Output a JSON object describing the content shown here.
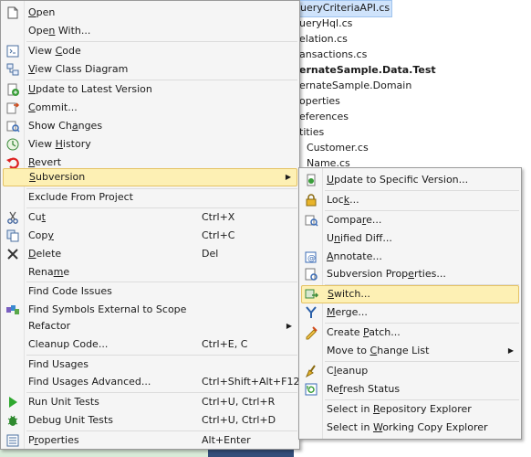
{
  "explorer": {
    "items": [
      {
        "text": "ueryCriteriaAPI.cs"
      },
      {
        "text": "ueryHql.cs"
      },
      {
        "text": "elation.cs"
      },
      {
        "text": "ansactions.cs"
      },
      {
        "text": "ernateSample.Data.Test"
      },
      {
        "text": "ernateSample.Domain"
      },
      {
        "text": "operties"
      },
      {
        "text": "eferences"
      },
      {
        "text": "tities"
      },
      {
        "text": "Customer.cs"
      },
      {
        "text": "Name.cs"
      }
    ]
  },
  "context_menu": {
    "items": [
      {
        "pre": "",
        "acc": "O",
        "post": "pen",
        "shortcut": "",
        "icon": "open-document-icon"
      },
      {
        "pre": "Ope",
        "acc": "n",
        "post": " With...",
        "shortcut": "",
        "icon": ""
      },
      {
        "pre": "View ",
        "acc": "C",
        "post": "ode",
        "shortcut": "",
        "icon": "view-code-icon"
      },
      {
        "pre": "",
        "acc": "V",
        "post": "iew Class Diagram",
        "shortcut": "",
        "icon": "class-diagram-icon"
      },
      {
        "pre": "",
        "acc": "U",
        "post": "pdate to Latest Version",
        "shortcut": "",
        "icon": "update-icon"
      },
      {
        "pre": "",
        "acc": "C",
        "post": "ommit...",
        "shortcut": "",
        "icon": "commit-icon"
      },
      {
        "pre": "Show Ch",
        "acc": "a",
        "post": "nges",
        "shortcut": "",
        "icon": "show-changes-icon"
      },
      {
        "pre": "View ",
        "acc": "H",
        "post": "istory",
        "shortcut": "",
        "icon": "history-icon"
      },
      {
        "pre": "",
        "acc": "R",
        "post": "evert",
        "shortcut": "",
        "icon": "revert-icon"
      },
      {
        "pre": "",
        "acc": "S",
        "post": "ubversion",
        "shortcut": "",
        "icon": ""
      },
      {
        "pre": "Exclude From Project",
        "acc": "",
        "post": "",
        "shortcut": "",
        "icon": ""
      },
      {
        "pre": "Cu",
        "acc": "t",
        "post": "",
        "shortcut": "Ctrl+X",
        "icon": "cut-icon"
      },
      {
        "pre": "Cop",
        "acc": "y",
        "post": "",
        "shortcut": "Ctrl+C",
        "icon": "copy-icon"
      },
      {
        "pre": "",
        "acc": "D",
        "post": "elete",
        "shortcut": "Del",
        "icon": "delete-icon"
      },
      {
        "pre": "Rena",
        "acc": "m",
        "post": "e",
        "shortcut": "",
        "icon": ""
      },
      {
        "pre": "Find Code Issues",
        "acc": "",
        "post": "",
        "shortcut": "",
        "icon": ""
      },
      {
        "pre": "Find Symbols External to Scope",
        "acc": "",
        "post": "",
        "shortcut": "",
        "icon": "find-symbols-icon"
      },
      {
        "pre": "Refactor",
        "acc": "",
        "post": "",
        "shortcut": "",
        "icon": ""
      },
      {
        "pre": "Cleanup Code...",
        "acc": "",
        "post": "",
        "shortcut": "Ctrl+E, C",
        "icon": ""
      },
      {
        "pre": "Find Usages",
        "acc": "",
        "post": "",
        "shortcut": "",
        "icon": ""
      },
      {
        "pre": "Find Usages Advanced...",
        "acc": "",
        "post": "",
        "shortcut": "Ctrl+Shift+Alt+F12",
        "icon": ""
      },
      {
        "pre": "Run Unit Tests",
        "acc": "",
        "post": "",
        "shortcut": "Ctrl+U, Ctrl+R",
        "icon": "run-tests-icon"
      },
      {
        "pre": "Debug Unit Tests",
        "acc": "",
        "post": "",
        "shortcut": "Ctrl+U, Ctrl+D",
        "icon": "debug-tests-icon"
      },
      {
        "pre": "P",
        "acc": "r",
        "post": "operties",
        "shortcut": "Alt+Enter",
        "icon": "properties-icon"
      }
    ]
  },
  "submenu": {
    "items": [
      {
        "pre": "",
        "acc": "U",
        "post": "pdate to Specific Version...",
        "icon": "update-specific-icon"
      },
      {
        "pre": "Loc",
        "acc": "k",
        "post": "...",
        "icon": "lock-icon"
      },
      {
        "pre": "Compa",
        "acc": "r",
        "post": "e...",
        "icon": "compare-icon"
      },
      {
        "pre": "U",
        "acc": "n",
        "post": "ified Diff...",
        "icon": ""
      },
      {
        "pre": "",
        "acc": "A",
        "post": "nnotate...",
        "icon": "annotate-icon"
      },
      {
        "pre": "Subversion Prop",
        "acc": "e",
        "post": "rties...",
        "icon": "subversion-properties-icon"
      },
      {
        "pre": "",
        "acc": "S",
        "post": "witch...",
        "icon": "switch-icon"
      },
      {
        "pre": "",
        "acc": "M",
        "post": "erge...",
        "icon": "merge-icon"
      },
      {
        "pre": "Create ",
        "acc": "P",
        "post": "atch...",
        "icon": "create-patch-icon"
      },
      {
        "pre": "Move to ",
        "acc": "C",
        "post": "hange List",
        "icon": ""
      },
      {
        "pre": "C",
        "acc": "l",
        "post": "eanup",
        "icon": "cleanup-icon"
      },
      {
        "pre": "Re",
        "acc": "f",
        "post": "resh Status",
        "icon": "refresh-icon"
      },
      {
        "pre": "Select in ",
        "acc": "R",
        "post": "epository Explorer",
        "icon": ""
      },
      {
        "pre": "Select in ",
        "acc": "W",
        "post": "orking Copy Explorer",
        "icon": ""
      }
    ]
  },
  "colors": {
    "menu_bg": "#f5f5f5",
    "highlight_bg": "#fdf0b4",
    "highlight_border": "#e5c365",
    "selection_bg": "#cfe3fb"
  }
}
